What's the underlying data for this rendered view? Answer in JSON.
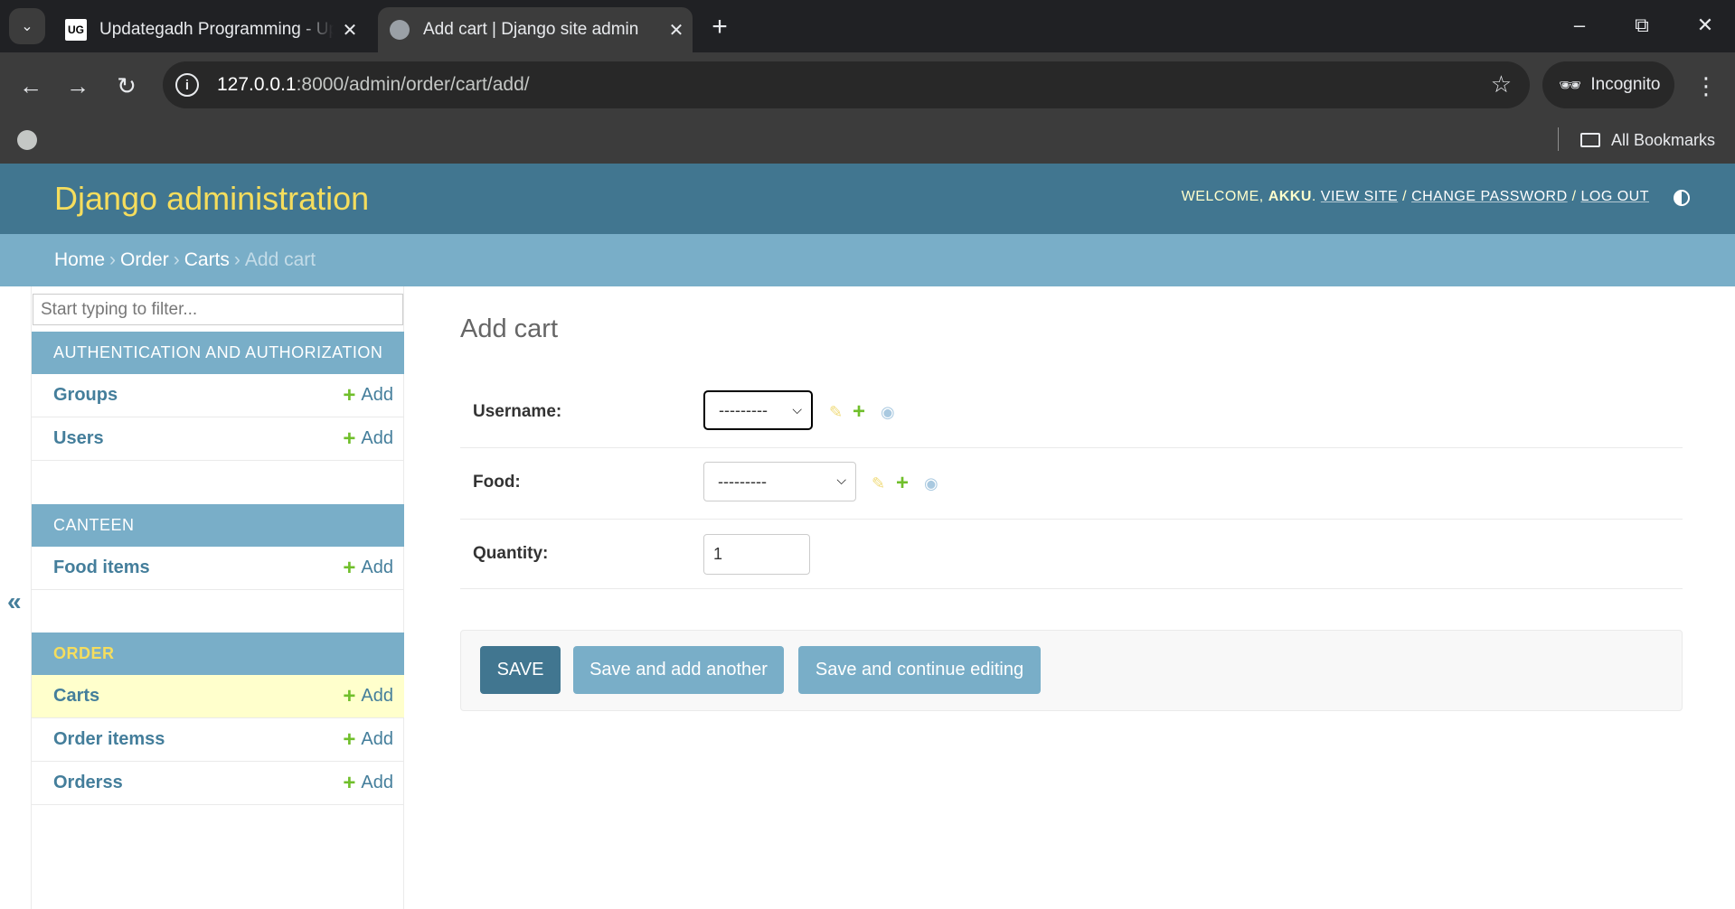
{
  "browser": {
    "tabs": [
      {
        "title": "Updategadh Programming - Up",
        "favicon": "ug-logo",
        "active": false
      },
      {
        "title": "Add cart | Django site admin",
        "favicon": "globe-icon",
        "active": true
      }
    ],
    "address": {
      "host": "127.0.0.1",
      "path": ":8000/admin/order/cart/add/"
    },
    "incognito_label": "Incognito",
    "all_bookmarks_label": "All Bookmarks",
    "favicon_logo_text": "UG"
  },
  "admin": {
    "site_title": "Django administration",
    "user_tools": {
      "welcome": "Welcome,",
      "username": "Akku",
      "view_site": "View site",
      "change_password": "Change password",
      "log_out": "Log out",
      "separator": "/"
    },
    "breadcrumbs": {
      "home": "Home",
      "app": "Order",
      "model": "Carts",
      "current": "Add cart",
      "separator": "›"
    },
    "sidebar": {
      "filter_placeholder": "Start typing to filter...",
      "toggle_label": "«",
      "add_label": "Add",
      "modules": [
        {
          "caption": "Authentication and Authorization",
          "current": false,
          "models": [
            {
              "name": "Groups",
              "selected": false
            },
            {
              "name": "Users",
              "selected": false
            }
          ]
        },
        {
          "caption": "Canteen",
          "current": false,
          "models": [
            {
              "name": "Food items",
              "selected": false
            }
          ]
        },
        {
          "caption": "Order",
          "current": true,
          "models": [
            {
              "name": "Carts",
              "selected": true
            },
            {
              "name": "Order itemss",
              "selected": false
            },
            {
              "name": "Orderss",
              "selected": false
            }
          ]
        }
      ]
    },
    "content": {
      "title": "Add cart",
      "fields": {
        "username": {
          "label": "Username:",
          "value": "---------"
        },
        "food": {
          "label": "Food:",
          "value": "---------"
        },
        "quantity": {
          "label": "Quantity:",
          "value": "1"
        }
      },
      "buttons": {
        "save": "Save",
        "save_add_another": "Save and add another",
        "save_continue": "Save and continue editing"
      }
    }
  }
}
